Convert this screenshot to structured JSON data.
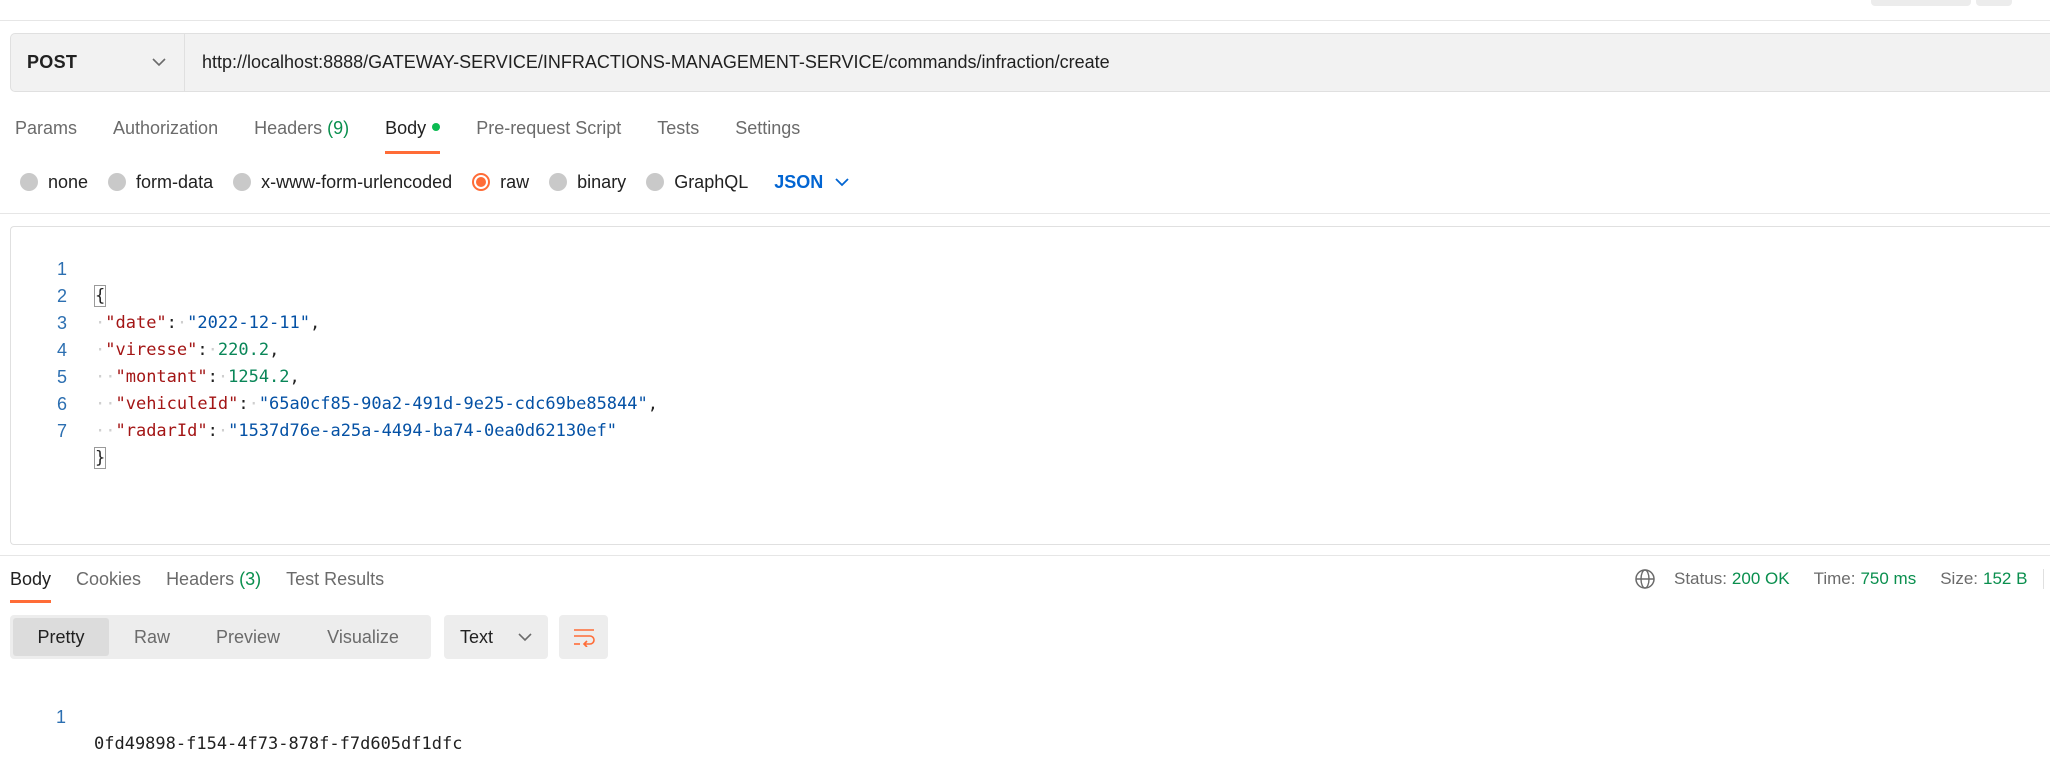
{
  "request": {
    "method": "POST",
    "url": "http://localhost:8888/GATEWAY-SERVICE/INFRACTIONS-MANAGEMENT-SERVICE/commands/infraction/create"
  },
  "request_tabs": {
    "params": "Params",
    "authorization": "Authorization",
    "headers": "Headers",
    "headers_count": "(9)",
    "body": "Body",
    "prerequest": "Pre-request Script",
    "tests": "Tests",
    "settings": "Settings"
  },
  "body_types": {
    "none": "none",
    "form_data": "form-data",
    "urlencoded": "x-www-form-urlencoded",
    "raw": "raw",
    "binary": "binary",
    "graphql": "GraphQL",
    "language": "JSON",
    "selected": "raw"
  },
  "editor": {
    "line_numbers": [
      "1",
      "2",
      "3",
      "4",
      "5",
      "6",
      "7"
    ],
    "open_brace": "{",
    "close_brace": "}",
    "date_key": "\"date\"",
    "date_value": "\"2022-12-11\"",
    "viresse_key": "\"viresse\"",
    "viresse_value": "220.2",
    "montant_key": "\"montant\"",
    "montant_value": "1254.2",
    "vehicule_key": "\"vehiculeId\"",
    "vehicule_value": "\"65a0cf85-90a2-491d-9e25-cdc69be85844\"",
    "radar_key": "\"radarId\"",
    "radar_value": "\"1537d76e-a25a-4494-ba74-0ea0d62130ef\""
  },
  "response_tabs": {
    "body": "Body",
    "cookies": "Cookies",
    "headers": "Headers",
    "headers_count": "(3)",
    "test_results": "Test Results"
  },
  "response_status": {
    "status_label": "Status:",
    "status_value": "200 OK",
    "time_label": "Time:",
    "time_value": "750 ms",
    "size_label": "Size:",
    "size_value": "152 B"
  },
  "view_modes": {
    "pretty": "Pretty",
    "raw": "Raw",
    "preview": "Preview",
    "visualize": "Visualize",
    "format": "Text"
  },
  "response_body": {
    "line_number": "1",
    "text": "0fd49898-f154-4f73-878f-f7d605df1dfc"
  },
  "colors": {
    "accent": "#ff6c37",
    "success": "#0a8f4e",
    "link_blue": "#0265d2",
    "json_key": "#a31515",
    "json_string": "#0451a5",
    "json_number": "#098658"
  },
  "icons": {
    "method_dropdown": "chevron-down-icon",
    "language_dropdown": "chevron-down-icon",
    "network": "globe-icon",
    "format_dropdown": "chevron-down-icon",
    "wrap": "wrap-lines-icon"
  }
}
